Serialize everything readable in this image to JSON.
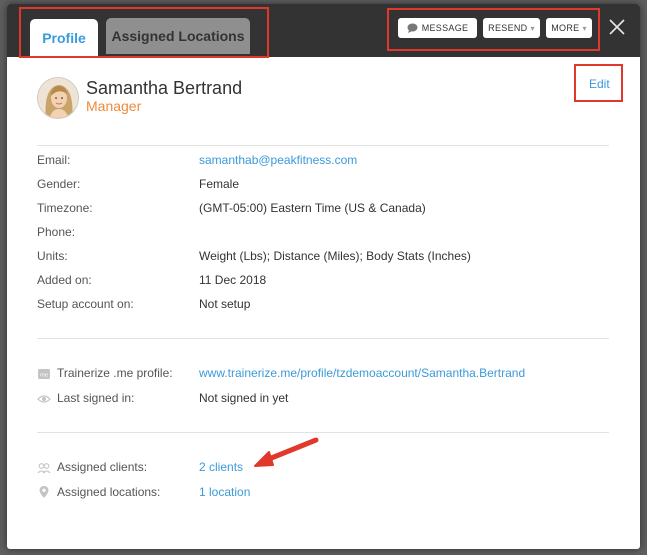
{
  "tabs": [
    {
      "label": "Profile",
      "active": true
    },
    {
      "label": "Assigned Locations",
      "active": false
    }
  ],
  "header_buttons": {
    "message": "MESSAGE",
    "resend": "RESEND",
    "more": "MORE"
  },
  "user": {
    "name": "Samantha Bertrand",
    "role": "Manager",
    "edit_label": "Edit"
  },
  "details": [
    {
      "label": "Email:",
      "value": "samanthab@peakfitness.com",
      "link": true
    },
    {
      "label": "Gender:",
      "value": "Female"
    },
    {
      "label": "Timezone:",
      "value": "(GMT-05:00) Eastern Time (US & Canada)"
    },
    {
      "label": "Phone:",
      "value": ""
    },
    {
      "label": "Units:",
      "value": "Weight (Lbs); Distance (Miles); Body Stats (Inches)"
    },
    {
      "label": "Added on:",
      "value": "11 Dec 2018"
    },
    {
      "label": "Setup account on:",
      "value": "Not setup"
    }
  ],
  "profile_section": {
    "me_profile_label": "Trainerize .me profile:",
    "me_profile_value": "www.trainerize.me/profile/tzdemoaccount/Samantha.Bertrand",
    "last_signed_label": "Last signed in:",
    "last_signed_value": "Not signed in yet"
  },
  "assigned_section": {
    "clients_label": "Assigned clients:",
    "clients_value": "2 clients",
    "locations_label": "Assigned locations:",
    "locations_value": "1 location"
  },
  "colors": {
    "accent": "#3b9ad9",
    "role": "#f08a3a",
    "annotation": "#e0392b",
    "topbar": "#333333"
  }
}
